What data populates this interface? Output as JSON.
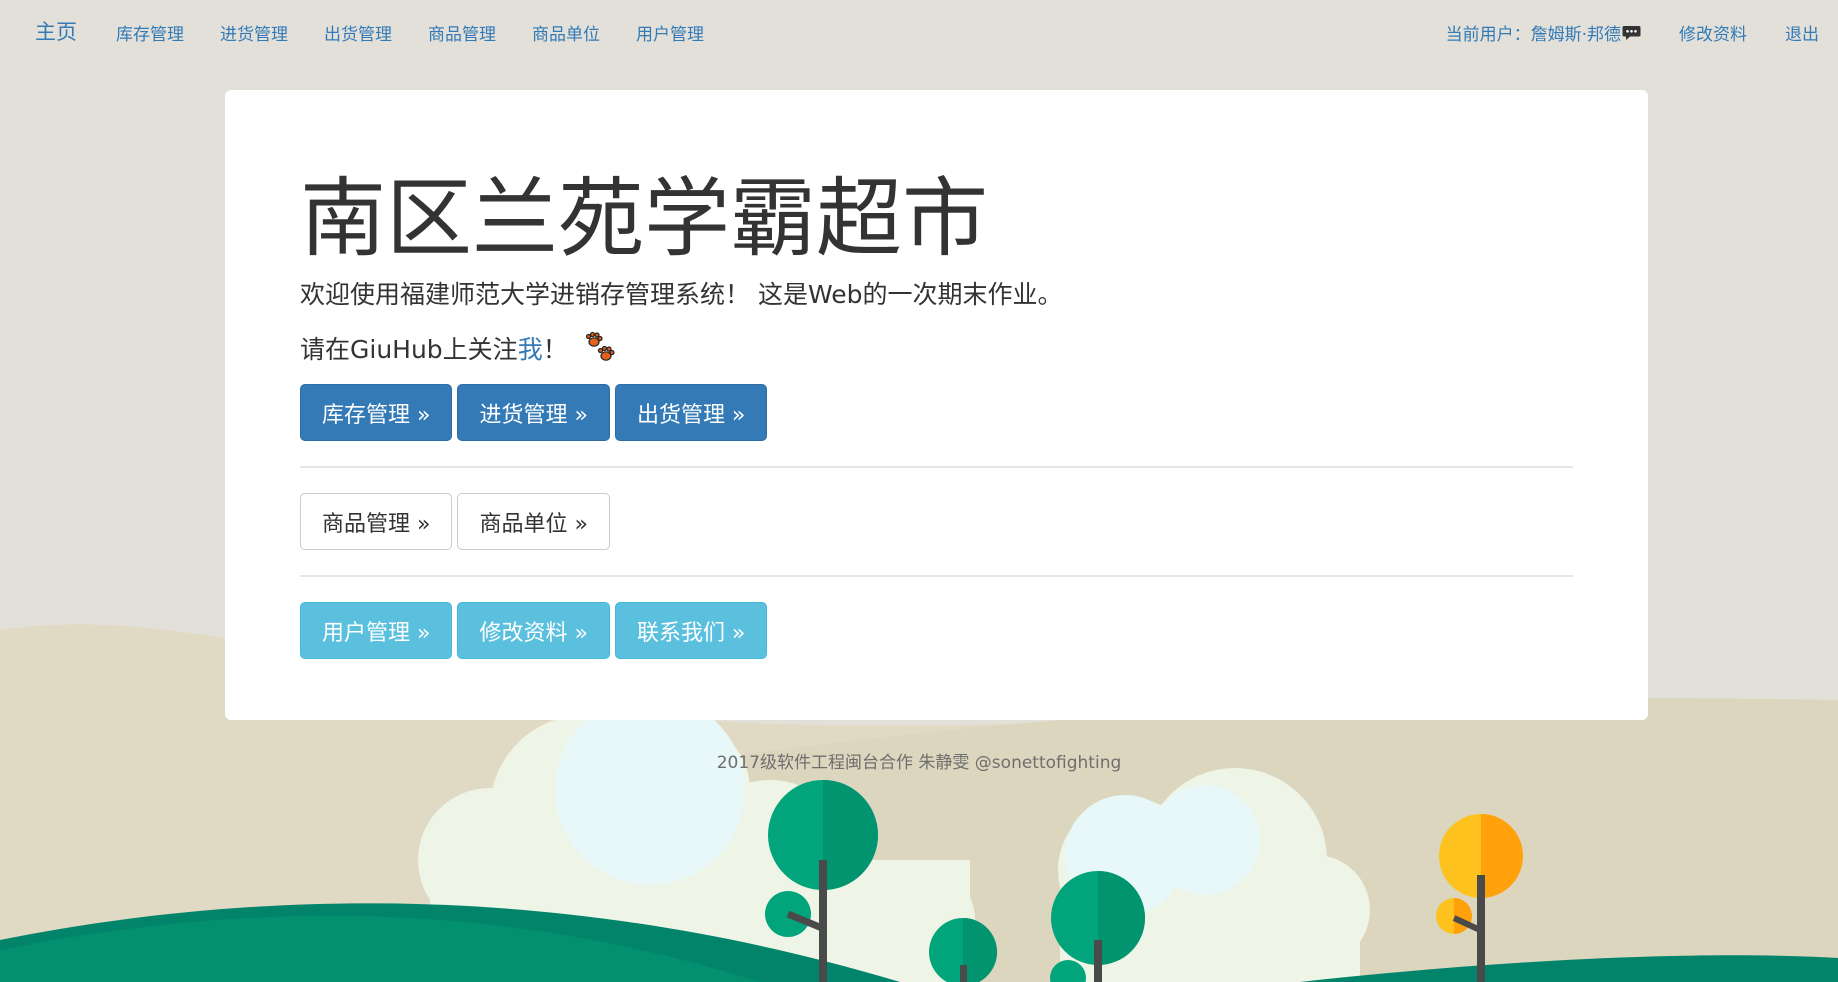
{
  "navbar": {
    "brand": "主页",
    "links": [
      "库存管理",
      "进货管理",
      "出货管理",
      "商品管理",
      "商品单位",
      "用户管理"
    ],
    "current_user": "当前用户：詹姆斯·邦德",
    "edit_profile": "修改资料",
    "logout": "退出"
  },
  "jumbotron": {
    "title": "南区兰苑学霸超市",
    "lead": "欢迎使用福建师范大学进销存管理系统！  这是Web的一次期末作业。",
    "follow_prefix": "请在GiuHub上关注",
    "follow_link": "我",
    "follow_suffix": "！",
    "primary_buttons": [
      "库存管理 »",
      "进货管理 »",
      "出货管理 »"
    ],
    "default_buttons": [
      "商品管理 »",
      "商品单位 »"
    ],
    "info_buttons": [
      "用户管理 »",
      "修改资料 »",
      "联系我们 »"
    ]
  },
  "footer": {
    "text": "2017级软件工程闽台合作 朱静雯 @sonettofighting"
  },
  "icons": {
    "chat": "chat-bubble-icon",
    "paw": "paw-prints-icon"
  },
  "colors": {
    "primary": "#337ab7",
    "info": "#5bc0de",
    "background": "#e3e0da",
    "tree_green": "#00a97e",
    "tree_orange": "#ffa10a"
  }
}
